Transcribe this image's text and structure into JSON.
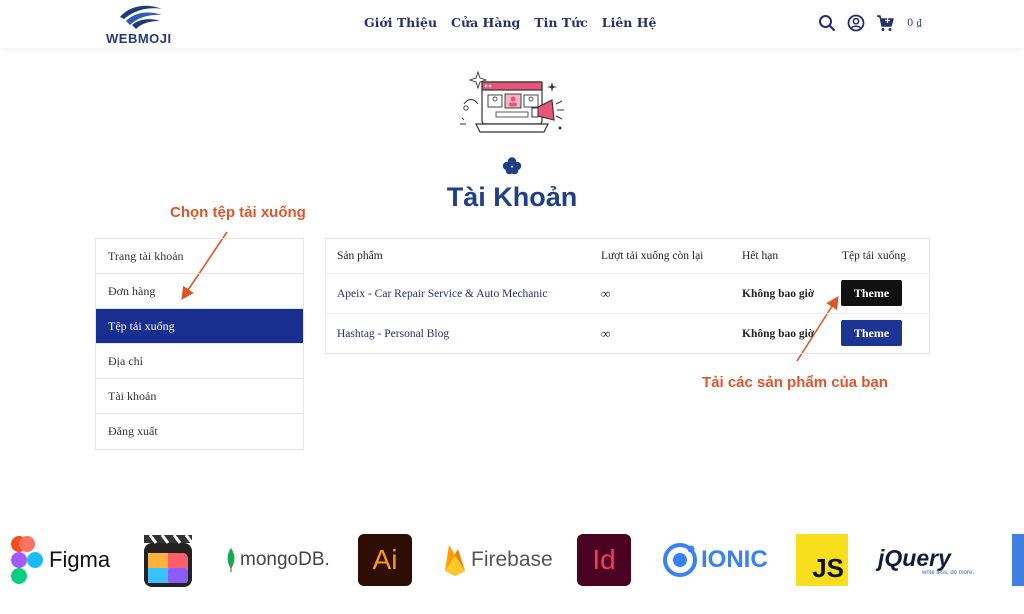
{
  "header": {
    "logo_text": "WEBMOJI",
    "nav": [
      "Giới Thiệu",
      "Cửa Hàng",
      "Tin Tức",
      "Liên Hệ"
    ],
    "icons": [
      "search-icon",
      "user-icon",
      "cart-icon"
    ],
    "cart_total": "0 ₫"
  },
  "page": {
    "title": "Tài Khoản"
  },
  "annotations": {
    "choose_files": "Chọn tệp tải xuống",
    "download_products": "Tải các sản phẩm của bạn"
  },
  "sidebar": {
    "items": [
      {
        "label": "Trang tài khoản",
        "active": false
      },
      {
        "label": "Đơn hàng",
        "active": false
      },
      {
        "label": "Tệp tải xuống",
        "active": true
      },
      {
        "label": "Địa chỉ",
        "active": false
      },
      {
        "label": "Tài khoản",
        "active": false
      },
      {
        "label": "Đăng xuất",
        "active": false
      }
    ]
  },
  "downloads": {
    "headers": [
      "Sản phẩm",
      "Lượt tải xuống còn lại",
      "Hết hạn",
      "Tệp tải xuống"
    ],
    "rows": [
      {
        "product": "Apeix - Car Repair Service & Auto Mechanic",
        "remaining": "∞",
        "expires": "Không bao giờ",
        "file": "Theme"
      },
      {
        "product": "Hashtag - Personal Blog",
        "remaining": "∞",
        "expires": "Không bao giờ",
        "file": "Theme"
      }
    ]
  },
  "tech_logos": {
    "figma": "Figma",
    "mongodb": "mongoDB.",
    "illustrator": "Ai",
    "firebase": "Firebase",
    "indesign": "Id",
    "ionic": "IONIC",
    "js": "JS",
    "jquery": "jQuery",
    "jquery_tagline": "write less, do more."
  },
  "colors": {
    "brand_navy": "#1f3f8a",
    "active_sidebar": "#182f8f",
    "annotation": "#e0542a",
    "button_dark": "#111111",
    "button_blue": "#1c3494"
  }
}
